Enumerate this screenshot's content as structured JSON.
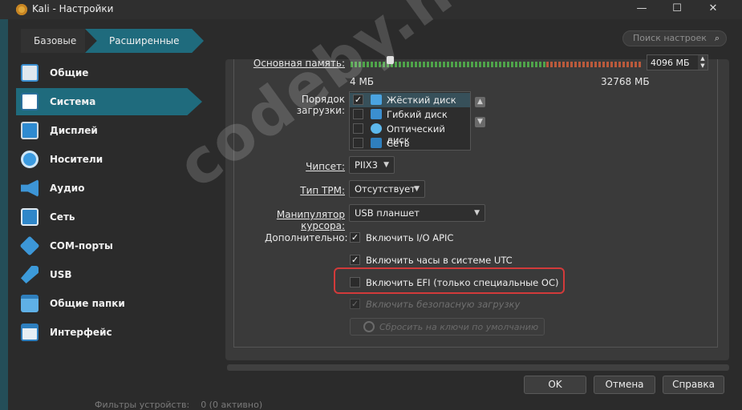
{
  "window": {
    "title": "Kali - Настройки",
    "controls": {
      "minimize": "—",
      "maximize": "☐",
      "close": "✕"
    }
  },
  "topbar": {
    "tabs": [
      {
        "label": "Базовые"
      },
      {
        "label": "Расширенные"
      }
    ],
    "search_placeholder": "Поиск настроек"
  },
  "sidebar": {
    "items": [
      {
        "label": "Общие",
        "icon": "general-icon"
      },
      {
        "label": "Система",
        "icon": "system-icon",
        "active": true
      },
      {
        "label": "Дисплей",
        "icon": "display-icon"
      },
      {
        "label": "Носители",
        "icon": "storage-icon"
      },
      {
        "label": "Аудио",
        "icon": "audio-icon"
      },
      {
        "label": "Сеть",
        "icon": "network-icon"
      },
      {
        "label": "COM-порты",
        "icon": "serial-icon"
      },
      {
        "label": "USB",
        "icon": "usb-icon"
      },
      {
        "label": "Общие папки",
        "icon": "shared-folders-icon"
      },
      {
        "label": "Интерфейс",
        "icon": "interface-icon"
      }
    ]
  },
  "system": {
    "memory": {
      "label": "Основная память:",
      "min": "4 МБ",
      "max": "32768 МБ",
      "value": "4096 МБ"
    },
    "boot_order": {
      "label": "Порядок загрузки:",
      "items": [
        {
          "label": "Жёсткий диск",
          "checked": true,
          "selected": true,
          "icon": "hard-disk-icon"
        },
        {
          "label": "Гибкий диск",
          "checked": false,
          "icon": "floppy-icon"
        },
        {
          "label": "Оптический диск",
          "checked": false,
          "icon": "optical-disk-icon"
        },
        {
          "label": "Сеть",
          "checked": false,
          "icon": "network-boot-icon"
        }
      ]
    },
    "chipset": {
      "label": "Чипсет:",
      "value": "PIIX3"
    },
    "tpm": {
      "label": "Тип TPM:",
      "value": "Отсутствует"
    },
    "pointing": {
      "label": "Манипулятор курсора:",
      "value": "USB планшет"
    },
    "extended": {
      "label": "Дополнительно:",
      "io_apic": {
        "label": "Включить I/O APIC",
        "checked": true
      },
      "utc": {
        "label": "Включить часы в системе UTC",
        "checked": true
      },
      "efi": {
        "label": "Включить EFI (только специальные ОС)",
        "checked": false
      },
      "secure_boot": {
        "label": "Включить безопасную загрузку",
        "checked": true,
        "disabled": true
      }
    },
    "reset_keys_label": "Сбросить на ключи по умолчанию"
  },
  "buttons": {
    "ok": "OK",
    "cancel": "Отмена",
    "help": "Справка"
  },
  "status": {
    "filters": "Фильтры устройств:",
    "count": "0 (0 активно)"
  },
  "watermark": "codeby.net",
  "colors": {
    "accent": "#1f6b7d",
    "highlight": "#d23a3a",
    "background": "#2b2b2b"
  }
}
